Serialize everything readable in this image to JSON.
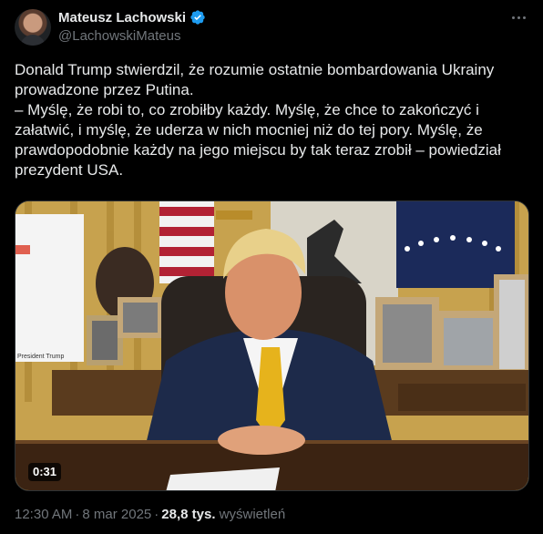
{
  "author": {
    "display_name": "Mateusz Lachowski",
    "handle": "@LachowskiMateus",
    "verified": true,
    "verified_icon": "verified-badge-icon",
    "accent_color": "#1d9bf0"
  },
  "tweet": {
    "text_lines": [
      "Donald Trump stwierdzil, że rozumie ostatnie bombardowania Ukrainy",
      "prowadzone przez Putina.",
      "– Myślę, że robi to, co zrobiłby każdy. Myślę, że chce to zakończyć i",
      "załatwić, i myślę, że uderza w nich mocniej niż do tej pory. Myślę, że",
      "prawdopodobnie każdy na jego miejscu by tak teraz zrobił – powiedział",
      "prezydent USA."
    ],
    "media": {
      "type": "video",
      "duration": "0:31",
      "placard_text": "President Trump"
    },
    "time": "12:30 AM",
    "date": "8 mar 2025",
    "views_count": "28,8 tys.",
    "views_label": "wyświetleń",
    "separator": "·"
  },
  "actions": {
    "more_icon": "more-icon"
  },
  "colors": {
    "background": "#000000",
    "text_primary": "#e7e9ea",
    "text_secondary": "#71767b",
    "border": "#2f3336"
  }
}
